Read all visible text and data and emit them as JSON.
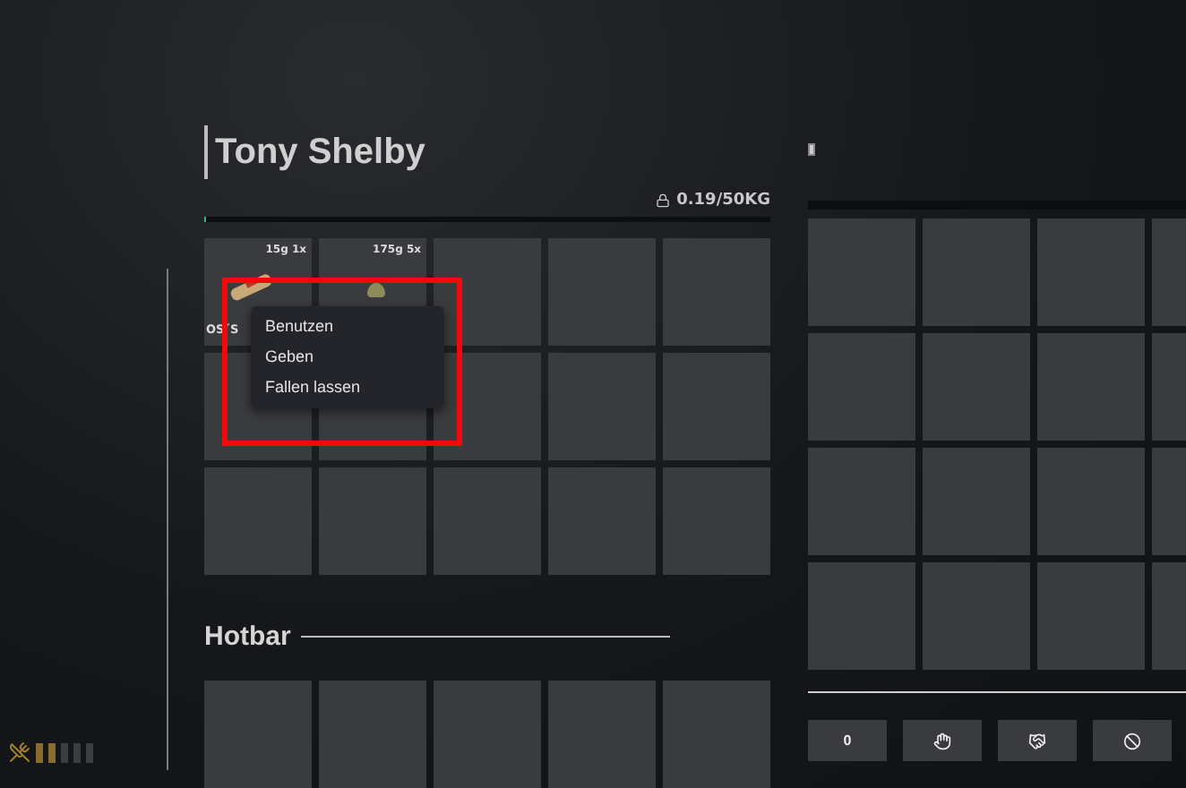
{
  "player": {
    "name": "Tony Shelby"
  },
  "weight": {
    "text": "0.19/50KG",
    "level": 0.004
  },
  "slots": [
    {
      "info": "15g 1x",
      "kind": "scroll",
      "label": "OS´S"
    },
    {
      "info": "175g 5x",
      "kind": "bag"
    }
  ],
  "context_menu": {
    "items": [
      "Benutzen",
      "Geben",
      "Fallen lassen"
    ]
  },
  "hotbar": {
    "title": "Hotbar"
  },
  "actions": [
    {
      "kind": "amount",
      "text": "0"
    },
    {
      "kind": "hand"
    },
    {
      "kind": "handshake"
    },
    {
      "kind": "ban"
    }
  ],
  "hunger_meter": {
    "level": 0.4
  }
}
